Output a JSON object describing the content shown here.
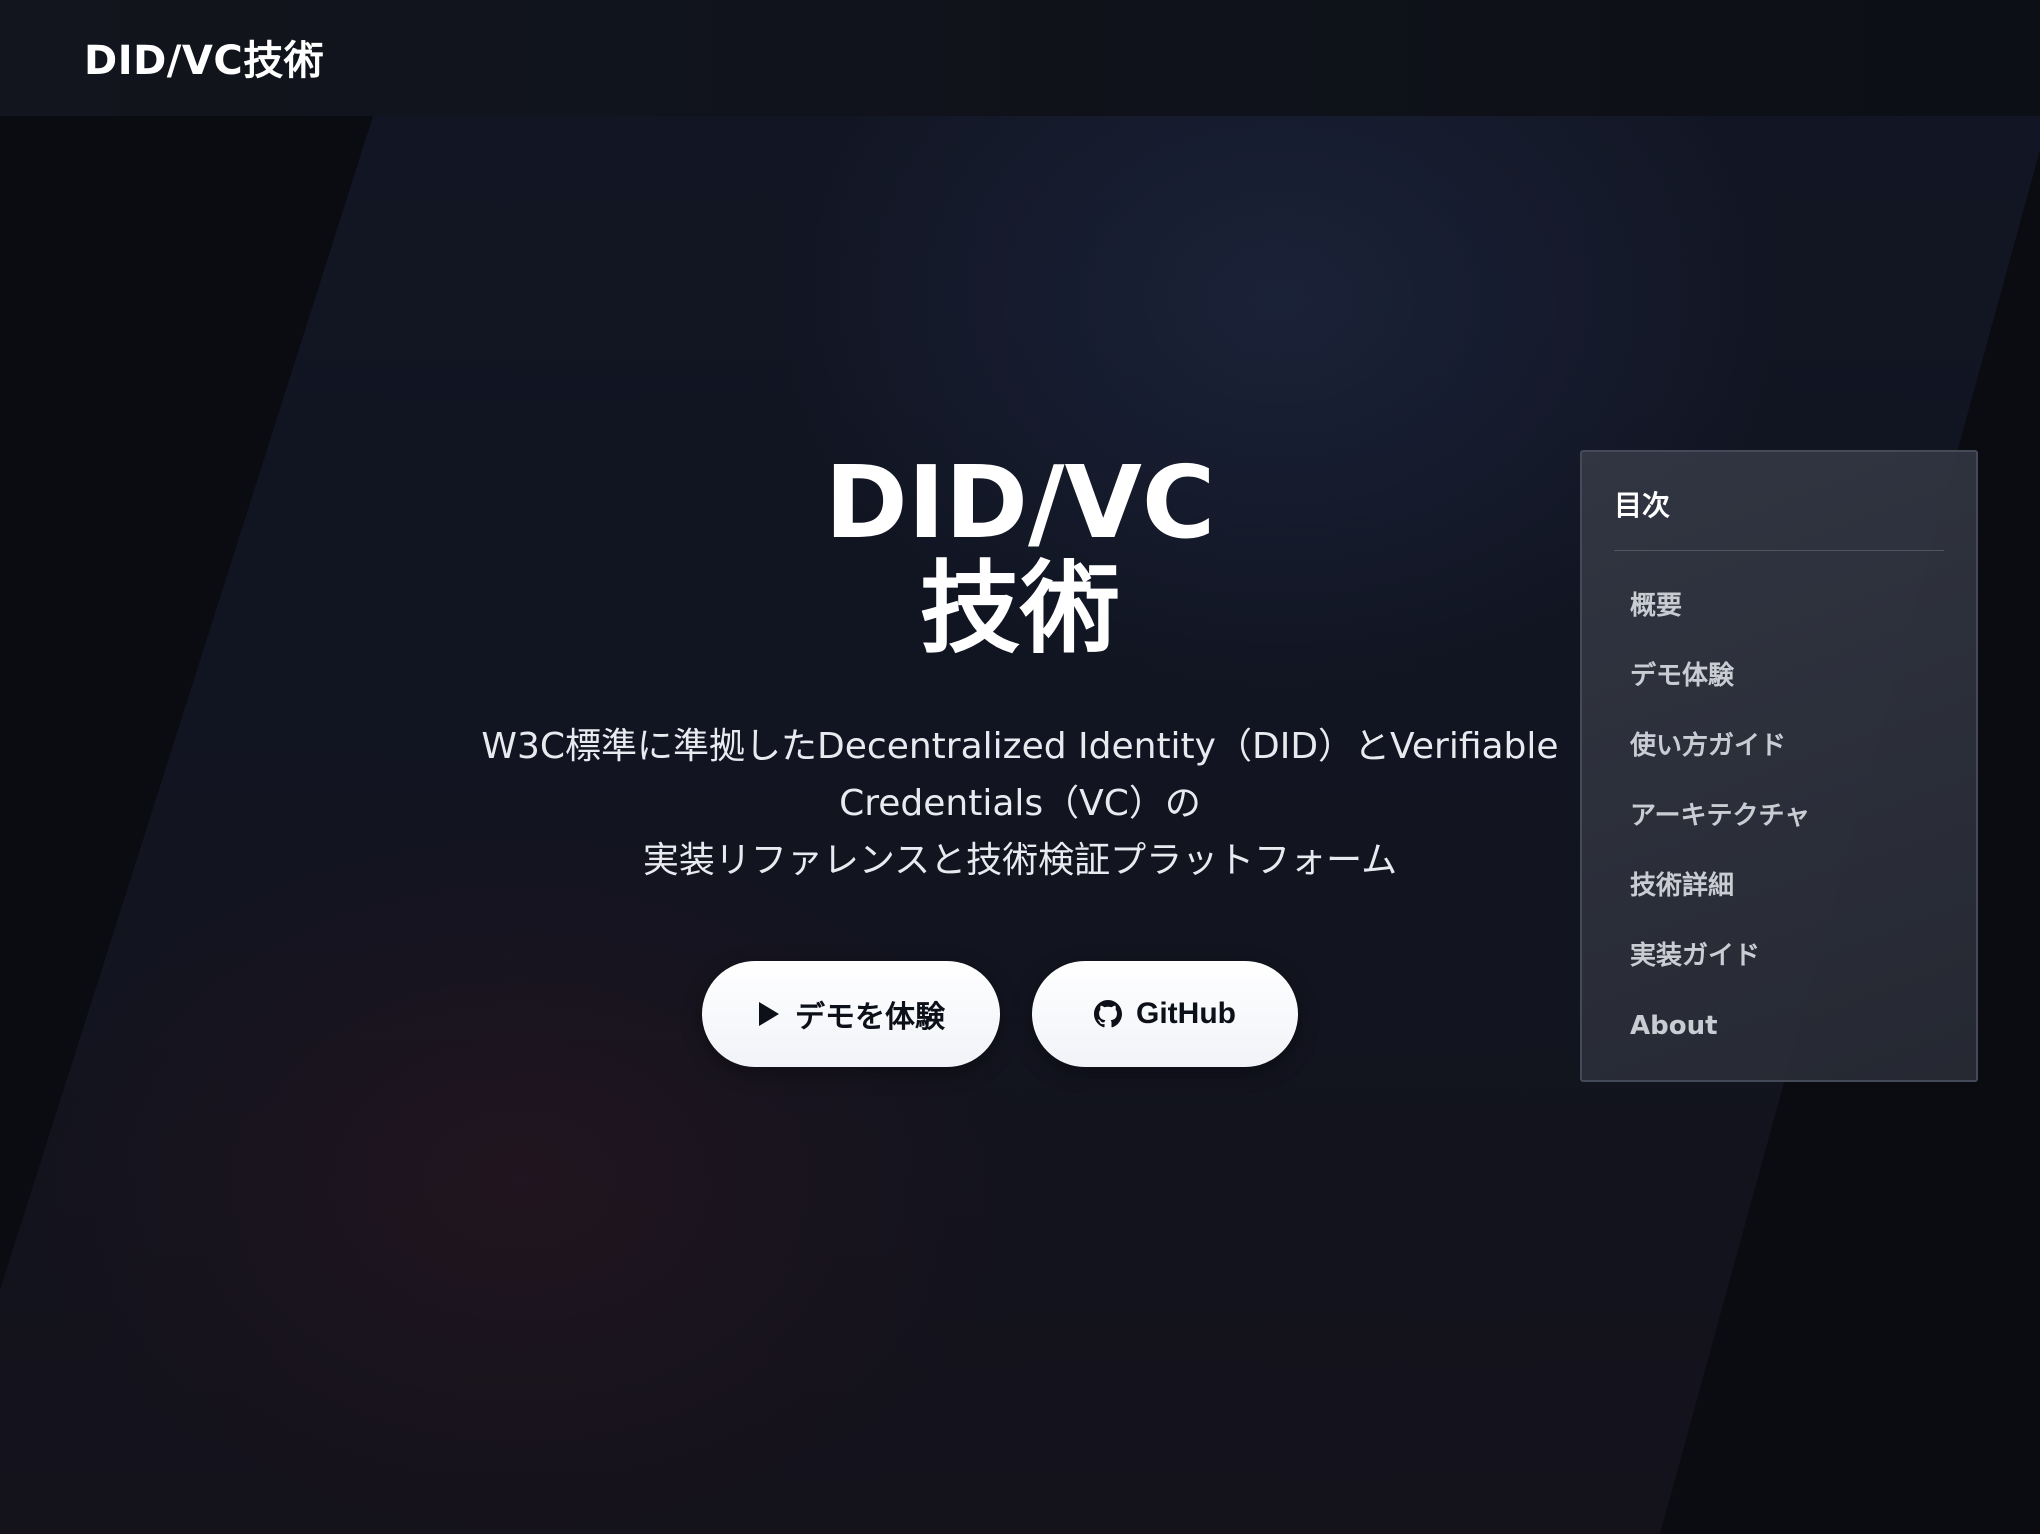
{
  "header": {
    "brand": "DID/VC技術"
  },
  "hero": {
    "title_line1": "DID/VC",
    "title_line2": "技術",
    "desc_line1": "W3C標準に準拠したDecentralized Identity（DID）とVerifiable",
    "desc_line2": "Credentials（VC）の",
    "desc_line3": "実装リファレンスと技術検証プラットフォーム",
    "demo_button": "デモを体験",
    "github_button": "GitHub"
  },
  "toc": {
    "title": "目次",
    "items": [
      {
        "label": "概要"
      },
      {
        "label": "デモ体験"
      },
      {
        "label": "使い方ガイド"
      },
      {
        "label": "アーキテクチャ"
      },
      {
        "label": "技術詳細"
      },
      {
        "label": "実装ガイド"
      },
      {
        "label": "About"
      }
    ]
  },
  "icons": {
    "demo": "play-icon",
    "github": "github-icon"
  }
}
